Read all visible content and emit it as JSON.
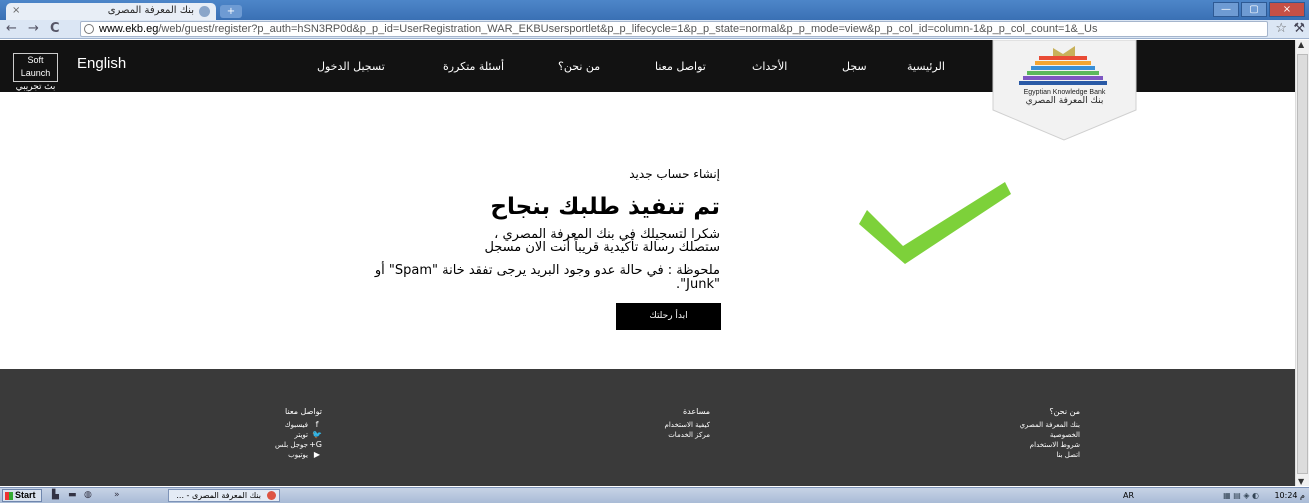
{
  "browser": {
    "tab_title": "بنك المعرفة المصرى",
    "tab_close": "×",
    "new_tab": "+",
    "window_buttons": [
      "—",
      "▢",
      "×"
    ],
    "url_host": "www.ekb.eg",
    "url_path": "/web/guest/register?p_auth=hSN3RP0d&p_p_id=UserRegistration_WAR_EKBUsersportlet&p_p_lifecycle=1&p_p_state=normal&p_p_mode=view&p_p_col_id=column-1&p_p_col_count=1&_Us",
    "back": "←",
    "forward": "→",
    "reload": "C",
    "star": "☆",
    "wrench": "⚒"
  },
  "header": {
    "soft_launch_line1": "Soft Launch",
    "soft_launch_line2": "بث تجريبي",
    "language": "English",
    "nav": {
      "login": "تسجيل الدخول",
      "faq": "أسئلة متكررة",
      "about": "من نحن؟",
      "contact": "تواصل معنا",
      "events": "الأحداث",
      "register": "سجل",
      "home": "الرئيسية"
    },
    "logo_en": "Egyptian Knowledge Bank",
    "logo_ar": "بنك المعرفة المصري"
  },
  "main": {
    "subtitle": "إنشاء حساب جديد",
    "title": "تم تنفيذ طلبك بنجاح",
    "message_line1": "شكرا لتسجيلك في بنك المعرفة المصري ،",
    "message_line2": "ستصلك رسالة تأكيدية قريباً أنت الان مسجل",
    "note_line1": "ملحوظة : في حالة عدو وجود البريد يرجى تفقد خانة \"Spam\" أو",
    "note_line2": "\"Junk\".",
    "cta": "ابدأ رحلتك"
  },
  "footer": {
    "about_col": {
      "heading": "من نحن؟",
      "links": [
        "بنك المعرفة المصري",
        "الخصوصية",
        "شروط الاستخدام",
        "اتصل بنا"
      ]
    },
    "help_col": {
      "heading": "مساعدة",
      "links": [
        "كيفية الاستخدام",
        "مركز الخدمات"
      ]
    },
    "contact_col": {
      "heading": "تواصل معنا",
      "links": [
        {
          "label": "فيسبوك",
          "icon": "f"
        },
        {
          "label": "تويتر",
          "icon": "🐦"
        },
        {
          "label": "جوجل بلس",
          "icon": "G+"
        },
        {
          "label": "يوتيوب",
          "icon": "▶"
        }
      ]
    }
  },
  "taskbar": {
    "start": "Start",
    "quick_chevron": "»",
    "task_label": "بنك المعرفة المصرى - ...",
    "language": "AR",
    "clock": "10:24 م"
  }
}
